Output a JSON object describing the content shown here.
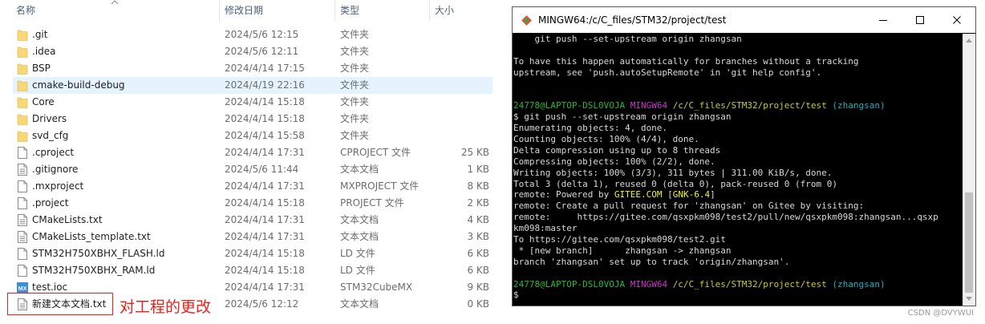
{
  "explorer": {
    "columns": {
      "name": "名称",
      "date": "修改日期",
      "type": "类型",
      "size": "大小"
    },
    "files": [
      {
        "icon": "folder-icon",
        "name": ".git",
        "date": "2024/5/6 12:15",
        "type": "文件夹",
        "size": ""
      },
      {
        "icon": "folder-icon",
        "name": ".idea",
        "date": "2024/5/6 12:11",
        "type": "文件夹",
        "size": ""
      },
      {
        "icon": "folder-icon",
        "name": "BSP",
        "date": "2024/4/14 17:15",
        "type": "文件夹",
        "size": ""
      },
      {
        "icon": "folder-icon",
        "name": "cmake-build-debug",
        "date": "2024/4/19 22:16",
        "type": "文件夹",
        "size": ""
      },
      {
        "icon": "folder-icon",
        "name": "Core",
        "date": "2024/4/14 15:18",
        "type": "文件夹",
        "size": ""
      },
      {
        "icon": "folder-icon",
        "name": "Drivers",
        "date": "2024/4/14 15:18",
        "type": "文件夹",
        "size": ""
      },
      {
        "icon": "folder-icon",
        "name": "svd_cfg",
        "date": "2024/4/14 15:58",
        "type": "文件夹",
        "size": ""
      },
      {
        "icon": "file-icon",
        "name": ".cproject",
        "date": "2024/4/14 17:31",
        "type": "CPROJECT 文件",
        "size": "25 KB"
      },
      {
        "icon": "text-file-icon",
        "name": ".gitignore",
        "date": "2024/5/6 11:44",
        "type": "文本文档",
        "size": "1 KB"
      },
      {
        "icon": "file-icon",
        "name": ".mxproject",
        "date": "2024/4/14 17:31",
        "type": "MXPROJECT 文件",
        "size": "8 KB"
      },
      {
        "icon": "file-icon",
        "name": ".project",
        "date": "2024/4/14 15:18",
        "type": "PROJECT 文件",
        "size": "2 KB"
      },
      {
        "icon": "text-file-icon",
        "name": "CMakeLists.txt",
        "date": "2024/4/14 17:31",
        "type": "文本文档",
        "size": "4 KB"
      },
      {
        "icon": "text-file-icon",
        "name": "CMakeLists_template.txt",
        "date": "2024/4/14 17:31",
        "type": "文本文档",
        "size": "3 KB"
      },
      {
        "icon": "file-icon",
        "name": "STM32H750XBHX_FLASH.ld",
        "date": "2024/4/14 15:18",
        "type": "LD 文件",
        "size": "6 KB"
      },
      {
        "icon": "file-icon",
        "name": "STM32H750XBHX_RAM.ld",
        "date": "2024/4/14 15:18",
        "type": "LD 文件",
        "size": "6 KB"
      },
      {
        "icon": "stm32cubemx-icon",
        "name": "test.ioc",
        "date": "2024/4/14 17:31",
        "type": "STM32CubeMX",
        "size": "9 KB"
      },
      {
        "icon": "text-file-icon",
        "name": "新建文本文档.txt",
        "date": "2024/5/6 12:12",
        "type": "文本文档",
        "size": "0 KB"
      }
    ],
    "selected_file": "cmake-build-debug",
    "annotation": "对工程的更改",
    "colors": {
      "annotation": "#e8231c",
      "selection": "#e5f3ff",
      "folder": "#f8d775"
    }
  },
  "terminal": {
    "title": "MINGW64:/c/C_files/STM32/project/test",
    "window_buttons": [
      "minimize-icon",
      "maximize-icon",
      "close-icon"
    ],
    "lines": [
      [
        {
          "t": "    git push --set-upstream origin zhangsan",
          "c": "white"
        }
      ],
      [
        {
          "t": "",
          "c": "white"
        }
      ],
      [
        {
          "t": "To have this happen automatically for branches without a tracking",
          "c": "white"
        }
      ],
      [
        {
          "t": "upstream, see 'push.autoSetupRemote' in 'git help config'.",
          "c": "white"
        }
      ],
      [
        {
          "t": "",
          "c": "white"
        }
      ],
      [
        {
          "t": "",
          "c": "white"
        }
      ],
      [
        {
          "t": "24778@LAPTOP-DSL0VOJA ",
          "c": "green"
        },
        {
          "t": "MINGW64 ",
          "c": "magenta"
        },
        {
          "t": "/c/C_files/STM32/project/test ",
          "c": "yellow"
        },
        {
          "t": "(zhangsan)",
          "c": "cyan"
        }
      ],
      [
        {
          "t": "$ git push --set-upstream origin zhangsan",
          "c": "white"
        }
      ],
      [
        {
          "t": "Enumerating objects: 4, done.",
          "c": "white"
        }
      ],
      [
        {
          "t": "Counting objects: 100% (4/4), done.",
          "c": "white"
        }
      ],
      [
        {
          "t": "Delta compression using up to 8 threads",
          "c": "white"
        }
      ],
      [
        {
          "t": "Compressing objects: 100% (2/2), done.",
          "c": "white"
        }
      ],
      [
        {
          "t": "Writing objects: 100% (3/3), 311 bytes | 311.00 KiB/s, done.",
          "c": "white"
        }
      ],
      [
        {
          "t": "Total 3 (delta 1), reused 0 (delta 0), pack-reused 0 (from 0)",
          "c": "white"
        }
      ],
      [
        {
          "t": "remote: Powered by ",
          "c": "white"
        },
        {
          "t": "GITEE.COM",
          "c": "bright-yellow"
        },
        {
          "t": " [",
          "c": "white"
        },
        {
          "t": "GNK-6.4",
          "c": "bright-yellow"
        },
        {
          "t": "]",
          "c": "white"
        }
      ],
      [
        {
          "t": "remote: Create a pull request for 'zhangsan' on Gitee by visiting:",
          "c": "white"
        }
      ],
      [
        {
          "t": "remote:     https://gitee.com/qsxpkm098/test2/pull/new/qsxpkm098:zhangsan...qsxp",
          "c": "white"
        }
      ],
      [
        {
          "t": "km098:master",
          "c": "white"
        }
      ],
      [
        {
          "t": "To https://gitee.com/qsxpkm098/test2.git",
          "c": "white"
        }
      ],
      [
        {
          "t": " * [new branch]      zhangsan -> zhangsan",
          "c": "white"
        }
      ],
      [
        {
          "t": "branch 'zhangsan' set up to track 'origin/zhangsan'.",
          "c": "white"
        }
      ],
      [
        {
          "t": "",
          "c": "white"
        }
      ],
      [
        {
          "t": "24778@LAPTOP-DSL0VOJA ",
          "c": "green"
        },
        {
          "t": "MINGW64 ",
          "c": "magenta"
        },
        {
          "t": "/c/C_files/STM32/project/test ",
          "c": "yellow"
        },
        {
          "t": "(zhangsan)",
          "c": "cyan"
        }
      ],
      [
        {
          "t": "$ ",
          "c": "white"
        }
      ]
    ]
  },
  "watermark": "CSDN @DVYWUI"
}
